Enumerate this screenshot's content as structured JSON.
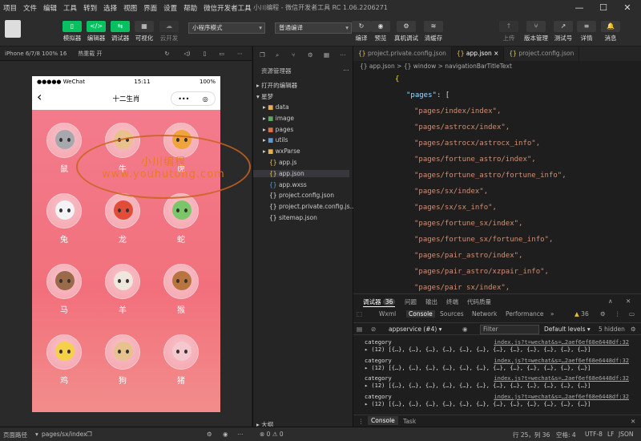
{
  "menu": [
    "项目",
    "文件",
    "编辑",
    "工具",
    "转到",
    "选择",
    "视图",
    "界面",
    "设置",
    "帮助",
    "微信开发者工具"
  ],
  "window_title": "小川编程 - 微信开发者工具 RC 1.06.2206271",
  "toolbar": {
    "simulator": "模拟器",
    "editor": "编辑器",
    "debugger": "调试器",
    "visual": "可视化",
    "cloud": "云开发",
    "mode_select": "小程序模式",
    "compile_select": "普通编译",
    "compile": "编译",
    "preview": "预览",
    "remote_debug": "真机调试",
    "clear_cache": "清缓存",
    "upload": "上传",
    "version": "版本管理",
    "test": "测试号",
    "details": "详情",
    "messages": "消息"
  },
  "simbar": {
    "device": "iPhone 6/7/8 100% 16",
    "hotreload": "热重载 开"
  },
  "phone": {
    "carrier": "●●●●● WeChat",
    "time": "15:11",
    "battery": "100%",
    "nav_title": "十二生肖",
    "back_icon": "‹",
    "more_icon": "•••",
    "record_icon": "◎"
  },
  "zodiac": [
    {
      "name": "鼠",
      "color": "#a7a7ae"
    },
    {
      "name": "牛",
      "color": "#e9c18d"
    },
    {
      "name": "虎",
      "color": "#f0a53c"
    },
    {
      "name": "兔",
      "color": "#f3f3f6"
    },
    {
      "name": "龙",
      "color": "#e24d3a"
    },
    {
      "name": "蛇",
      "color": "#7cc66a"
    },
    {
      "name": "马",
      "color": "#9a6a4a"
    },
    {
      "name": "羊",
      "color": "#efe7dd"
    },
    {
      "name": "猴",
      "color": "#b8753f"
    },
    {
      "name": "鸡",
      "color": "#f7d04a"
    },
    {
      "name": "狗",
      "color": "#e7c28e"
    },
    {
      "name": "猪",
      "color": "#f5c7cf"
    }
  ],
  "watermark": {
    "brand": "小川编程",
    "url": "www.youhutong.com"
  },
  "explorer": {
    "title": "资源管理器",
    "open_editors": "打开的编辑器",
    "project": "星梦",
    "outline": "大纲",
    "items": [
      {
        "label": "data",
        "type": "folder",
        "color": "#e8b04a"
      },
      {
        "label": "image",
        "type": "folder",
        "color": "#5ca85c"
      },
      {
        "label": "pages",
        "type": "folder",
        "color": "#e06c4a"
      },
      {
        "label": "utils",
        "type": "folder",
        "color": "#5a9bd4"
      },
      {
        "label": "wxParse",
        "type": "folder",
        "color": "#e8b04a"
      },
      {
        "label": "app.js",
        "type": "file",
        "color": "#e8c84a"
      },
      {
        "label": "app.json",
        "type": "file",
        "color": "#e8c84a"
      },
      {
        "label": "app.wxss",
        "type": "file",
        "color": "#5a9bd4"
      },
      {
        "label": "project.config.json",
        "type": "file",
        "color": "#ddd"
      },
      {
        "label": "project.private.config.js...",
        "type": "file",
        "color": "#ddd"
      },
      {
        "label": "sitemap.json",
        "type": "file",
        "color": "#ddd"
      }
    ]
  },
  "tabs": [
    {
      "label": "project.private.config.json"
    },
    {
      "label": "app.json",
      "active": true
    },
    {
      "label": "project.config.json"
    }
  ],
  "breadcrumb": "{} app.json > {} window > navigationBarTitleText",
  "code": {
    "open": "{",
    "key": "\"pages\"",
    "colon": ": [",
    "pages": [
      "\"pages/index/index\",",
      "\"pages/astrocx/index\",",
      "\"pages/astrocx/astrocx_info\",",
      "\"pages/fortune_astro/index\",",
      "\"pages/fortune_astro/fortune_info\",",
      "\"pages/sx/index\",",
      "\"pages/sx/sx_info\",",
      "\"pages/fortune_sx/index\",",
      "\"pages/fortune_sx/fortune_info\",",
      "\"pages/pair_astro/index\",",
      "\"pages/pair_astro/xzpair_info\",",
      "\"pages/pair sx/index\","
    ]
  },
  "devtools": {
    "title": "调试器",
    "count": "36",
    "issues": "问题",
    "output": "输出",
    "terminal": "终端",
    "quality": "代码质量",
    "tabs": [
      "Wxml",
      "Console",
      "Sources",
      "Network",
      "Performance"
    ],
    "warn_count": "36",
    "context": "appservice (#4)",
    "filter": "Filter",
    "levels": "Default levels",
    "hidden": "5 hidden",
    "logs": [
      {
        "label": "category",
        "src": "index.js?t=wechat&s=…2aef6ef68e6448df:32",
        "array": "▸ (12) [{…}, {…}, {…}, {…}, {…}, {…}, {…}, {…}, {…}, {…}, {…}, {…}]"
      },
      {
        "label": "category",
        "src": "index.js?t=wechat&s=…2aef6ef68e6448df:32",
        "array": "▸ (12) [{…}, {…}, {…}, {…}, {…}, {…}, {…}, {…}, {…}, {…}, {…}, {…}]"
      },
      {
        "label": "category",
        "src": "index.js?t=wechat&s=…2aef6ef68e6448df:32",
        "array": "▸ (12) [{…}, {…}, {…}, {…}, {…}, {…}, {…}, {…}, {…}, {…}, {…}, {…}]"
      },
      {
        "label": "category",
        "src": "index.js?t=wechat&s=…2aef6ef68e6448df:32",
        "array": "▸ (12) [{…}, {…}, {…}, {…}, {…}, {…}, {…}, {…}, {…}, {…}, {…}, {…}]"
      }
    ],
    "bottom_tabs": [
      "Console",
      "Task"
    ]
  },
  "statusbar": {
    "path_label": "页面路径",
    "path": "pages/sx/index",
    "errors": "⊗ 0 ⚠ 0",
    "position": "行 25，列 36",
    "spaces": "空格: 4",
    "encoding": "UTF-8",
    "eol": "LF",
    "lang": "JSON"
  }
}
